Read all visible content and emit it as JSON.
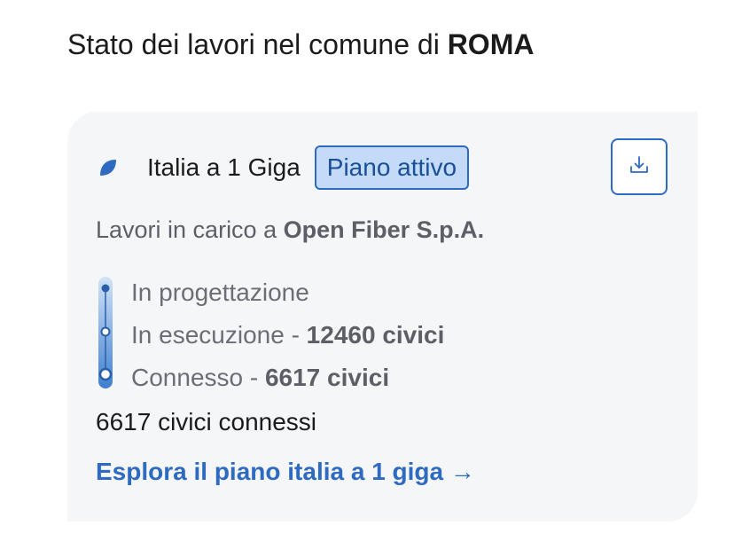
{
  "header": {
    "title_prefix": "Stato dei lavori nel comune di",
    "city": "ROMA"
  },
  "card": {
    "plan_name": "Italia a 1 Giga",
    "plan_status": "Piano attivo",
    "operator_prefix": "Lavori in carico a",
    "operator_name": "Open Fiber S.p.A.",
    "steps": [
      {
        "label": "In progettazione",
        "value": ""
      },
      {
        "label": "In esecuzione - ",
        "value": "12460 civici"
      },
      {
        "label": "Connesso - ",
        "value": "6617 civici"
      }
    ],
    "connected_summary": "6617 civici connessi",
    "explore_link": "Esplora il piano italia a 1 giga",
    "explore_arrow": "→"
  },
  "icons": {
    "leaf": "leaf-icon",
    "download": "download-icon"
  },
  "colors": {
    "accent": "#2e6bc0",
    "badge_bg": "#c3dbf8",
    "card_bg": "#f5f6f8"
  }
}
